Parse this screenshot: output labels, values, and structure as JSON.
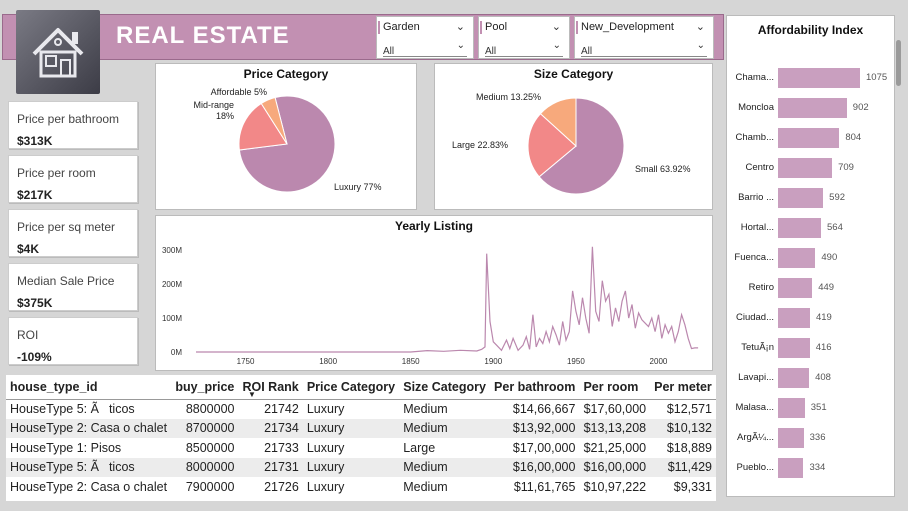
{
  "header": {
    "title": "REAL ESTATE"
  },
  "slicers": [
    {
      "label": "Garden",
      "value": "All"
    },
    {
      "label": "Pool",
      "value": "All"
    },
    {
      "label": "New_Development",
      "value": "All"
    }
  ],
  "kpis": [
    {
      "label": "Price per bathroom",
      "value": "$313K"
    },
    {
      "label": "Price per room",
      "value": "$217K"
    },
    {
      "label": "Price per sq meter",
      "value": "$4K"
    },
    {
      "label": "Median Sale Price",
      "value": "$375K"
    },
    {
      "label": "ROI",
      "value": "-109%"
    }
  ],
  "colors": {
    "accent": "#c290b2",
    "series_main": "#bb88ae",
    "series_mid": "#f28888",
    "series_small": "#f7a97c",
    "bar": "#c99fbf"
  },
  "chart_data": [
    {
      "type": "pie",
      "title": "Price Category",
      "slices": [
        {
          "name": "Luxury",
          "label": "Luxury 77%",
          "value": 77
        },
        {
          "name": "Mid-range",
          "label": "Mid-range 18%",
          "value": 18
        },
        {
          "name": "Affordable",
          "label": "Affordable 5%",
          "value": 5
        }
      ]
    },
    {
      "type": "pie",
      "title": "Size Category",
      "slices": [
        {
          "name": "Small",
          "label": "Small 63.92%",
          "value": 63.92
        },
        {
          "name": "Large",
          "label": "Large 22.83%",
          "value": 22.83
        },
        {
          "name": "Medium",
          "label": "Medium 13.25%",
          "value": 13.25
        }
      ]
    },
    {
      "type": "line",
      "title": "Yearly Listing",
      "x_ticks": [
        1750,
        1800,
        1850,
        1900,
        1950,
        2000
      ],
      "y_ticks": [
        "0M",
        "100M",
        "200M",
        "300M"
      ],
      "xlim": [
        1720,
        2030
      ],
      "ylim": [
        0,
        330
      ],
      "x": [
        1720,
        1850,
        1860,
        1870,
        1880,
        1890,
        1893,
        1895,
        1896,
        1898,
        1900,
        1902,
        1905,
        1908,
        1910,
        1912,
        1915,
        1918,
        1920,
        1922,
        1924,
        1926,
        1928,
        1930,
        1932,
        1934,
        1936,
        1938,
        1940,
        1942,
        1944,
        1946,
        1948,
        1950,
        1952,
        1954,
        1956,
        1958,
        1960,
        1962,
        1964,
        1966,
        1968,
        1970,
        1972,
        1974,
        1976,
        1978,
        1980,
        1982,
        1984,
        1986,
        1988,
        1990,
        1992,
        1994,
        1996,
        1998,
        2000,
        2002,
        2004,
        2006,
        2008,
        2010,
        2012,
        2014,
        2016,
        2018,
        2020,
        2022,
        2024
      ],
      "values": [
        0,
        0,
        4,
        2,
        5,
        3,
        8,
        15,
        290,
        90,
        30,
        20,
        5,
        35,
        10,
        40,
        5,
        20,
        45,
        8,
        110,
        15,
        40,
        25,
        60,
        30,
        75,
        50,
        20,
        90,
        35,
        60,
        180,
        120,
        80,
        160,
        100,
        55,
        310,
        120,
        90,
        210,
        150,
        170,
        75,
        130,
        90,
        150,
        180,
        100,
        140,
        70,
        115,
        95,
        85,
        75,
        100,
        60,
        110,
        40,
        80,
        55,
        75,
        30,
        60,
        110,
        80,
        40,
        10,
        12,
        12
      ]
    },
    {
      "type": "bar",
      "title": "Affordability Index",
      "categories": [
        "Chama...",
        "Moncloa",
        "Chamb...",
        "Centro",
        "Barrio ...",
        "Hortal...",
        "Fuenca...",
        "Retiro",
        "Ciudad...",
        "TetuÃ¡n",
        "Lavapi...",
        "Malasa...",
        "ArgÃ¼...",
        "Pueblo..."
      ],
      "values": [
        1075,
        902,
        804,
        709,
        592,
        564,
        490,
        449,
        419,
        416,
        408,
        351,
        336,
        334
      ],
      "xlim": [
        0,
        1075
      ]
    }
  ],
  "table": {
    "columns": [
      "house_type_id",
      "buy_price",
      "ROI Rank",
      "Price Category",
      "Size Category",
      "Per bathroom",
      "Per room",
      "Per meter"
    ],
    "rows": [
      [
        "HouseType 5: Ãticos",
        "8800000",
        "21742",
        "Luxury",
        "Medium",
        "$14,66,667",
        "$17,60,000",
        "$12,571"
      ],
      [
        "HouseType 2: Casa o chalet",
        "8700000",
        "21734",
        "Luxury",
        "Medium",
        "$13,92,000",
        "$13,13,208",
        "$10,132"
      ],
      [
        "HouseType 1: Pisos",
        "8500000",
        "21733",
        "Luxury",
        "Large",
        "$17,00,000",
        "$21,25,000",
        "$18,889"
      ],
      [
        "HouseType 5: Ãticos",
        "8000000",
        "21731",
        "Luxury",
        "Medium",
        "$16,00,000",
        "$16,00,000",
        "$11,429"
      ],
      [
        "HouseType 2: Casa o chalet",
        "7900000",
        "21726",
        "Luxury",
        "Medium",
        "$11,61,765",
        "$10,97,222",
        "$9,331"
      ]
    ]
  }
}
